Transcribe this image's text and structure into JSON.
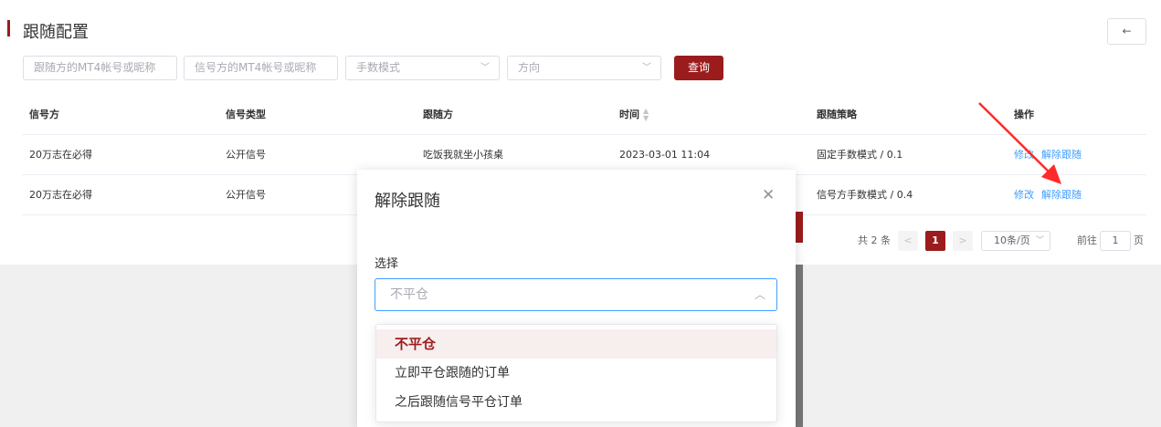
{
  "page": {
    "title": "跟随配置",
    "back_icon": "←"
  },
  "filters": {
    "follower_placeholder": "跟随方的MT4帐号或昵称",
    "signal_placeholder": "信号方的MT4帐号或昵称",
    "lot_mode_placeholder": "手数模式",
    "direction_placeholder": "方向",
    "query_label": "查询"
  },
  "table": {
    "headers": {
      "signal": "信号方",
      "signal_type": "信号类型",
      "follower": "跟随方",
      "time": "时间",
      "strategy": "跟随策略",
      "actions": "操作"
    },
    "rows": [
      {
        "signal": "20万志在必得",
        "signal_type": "公开信号",
        "follower": "吃饭我就坐小孩桌",
        "time": "2023-03-01 11:04",
        "strategy": "固定手数模式 / 0.1",
        "edit": "修改",
        "unfollow": "解除跟随"
      },
      {
        "signal": "20万志在必得",
        "signal_type": "公开信号",
        "follower": "",
        "time": "",
        "strategy": "信号方手数模式 / 0.4",
        "edit": "修改",
        "unfollow": "解除跟随"
      }
    ]
  },
  "pagination": {
    "total": "共 2 条",
    "prev": "<",
    "current_page": "1",
    "next": ">",
    "page_size": "10条/页",
    "goto_prefix": "前往",
    "goto_value": "1",
    "goto_suffix": "页"
  },
  "dialog": {
    "title": "解除跟随",
    "close_icon": "✕",
    "field_label": "选择",
    "select_value": "不平仓",
    "options": [
      "不平仓",
      "立即平仓跟随的订单",
      "之后跟随信号平仓订单"
    ]
  },
  "colors": {
    "primary": "#9b1c1c",
    "link": "#409eff",
    "annotation_arrow": "#ff2a2a"
  }
}
